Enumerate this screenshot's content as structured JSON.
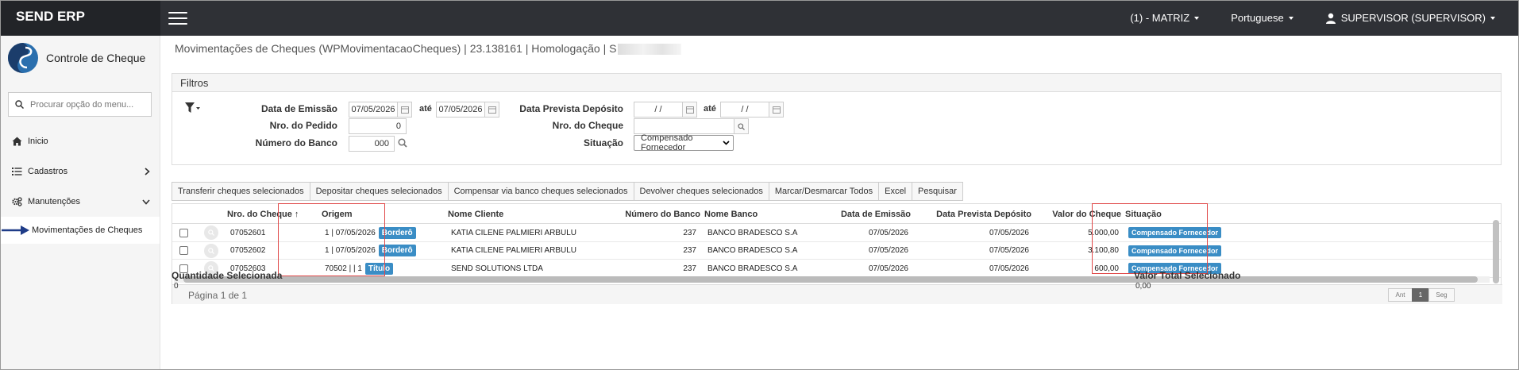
{
  "app": {
    "brand": "SEND ERP",
    "company": "(1) - MATRIZ",
    "language": "Portuguese",
    "user": "SUPERVISOR (SUPERVISOR)"
  },
  "sidebar": {
    "app_title": "Controle de Cheque",
    "search_placeholder": "Procurar opção do menu...",
    "items": [
      {
        "label": "Inicio",
        "icon": "home-icon"
      },
      {
        "label": "Cadastros",
        "icon": "list-icon"
      },
      {
        "label": "Manutenções",
        "icon": "gears-icon"
      }
    ],
    "subitem": "Movimentações de Cheques"
  },
  "page": {
    "title": "Movimentações de Cheques (WPMovimentacaoCheques) | 23.138161 | Homologação | S"
  },
  "filters": {
    "heading": "Filtros",
    "data_emissao_label": "Data de Emissão",
    "data_emissao_from": "07/05/2026",
    "ate1": "até",
    "data_emissao_to": "07/05/2026",
    "nro_pedido_label": "Nro. do Pedido",
    "nro_pedido": "0",
    "numero_banco_label": "Número do Banco",
    "numero_banco": "000",
    "data_prevista_label": "Data Prevista Depósito",
    "data_prevista_from": "/ /",
    "ate2": "até",
    "data_prevista_to": "/ /",
    "nro_cheque_label": "Nro. do Cheque",
    "nro_cheque": "",
    "situacao_label": "Situação",
    "situacao": "Compensado Fornecedor"
  },
  "toolbar": {
    "buttons": [
      "Transferir cheques selecionados",
      "Depositar cheques selecionados",
      "Compensar via banco cheques selecionados",
      "Devolver cheques selecionados",
      "Marcar/Desmarcar Todos",
      "Excel",
      "Pesquisar"
    ]
  },
  "grid": {
    "columns": [
      "Nro. do Cheque",
      "Origem",
      "Nome Cliente",
      "Número do Banco",
      "Nome Banco",
      "Data de Emissão",
      "Data Prevista Depósito",
      "Valor do Cheque",
      "Situação"
    ],
    "sort_indicator": "↑",
    "rows": [
      {
        "cheque": "07052601",
        "origem": "1 | 07/05/2026",
        "origem_badge": "Borderô",
        "cliente": "KATIA CILENE PALMIERI ARBULU",
        "banco_num": "237",
        "banco_nome": "BANCO BRADESCO S.A",
        "emissao": "07/05/2026",
        "prevista": "07/05/2026",
        "valor": "5.000,00",
        "situacao": "Compensado Fornecedor"
      },
      {
        "cheque": "07052602",
        "origem": "1 | 07/05/2026",
        "origem_badge": "Borderô",
        "cliente": "KATIA CILENE PALMIERI ARBULU",
        "banco_num": "237",
        "banco_nome": "BANCO BRADESCO S.A",
        "emissao": "07/05/2026",
        "prevista": "07/05/2026",
        "valor": "3.100,80",
        "situacao": "Compensado Fornecedor"
      },
      {
        "cheque": "07052603",
        "origem": "70502 | | 1",
        "origem_badge": "Título",
        "cliente": "SEND SOLUTIONS LTDA",
        "banco_num": "237",
        "banco_nome": "BANCO BRADESCO S.A",
        "emissao": "07/05/2026",
        "prevista": "07/05/2026",
        "valor": "600,00",
        "situacao": "Compensado Fornecedor"
      }
    ],
    "pager_text": "Página 1 de 1",
    "prev": "Ant",
    "page": "1",
    "next": "Seg"
  },
  "footer": {
    "qtd_label": "Quantidade Selecionada",
    "qtd_value": "0",
    "valor_label": "Valor Total Selecionado",
    "valor_value": "0,00"
  },
  "colors": {
    "topbar": "#2f3136",
    "badge": "#3a8dc5",
    "highlight": "#e04848"
  }
}
